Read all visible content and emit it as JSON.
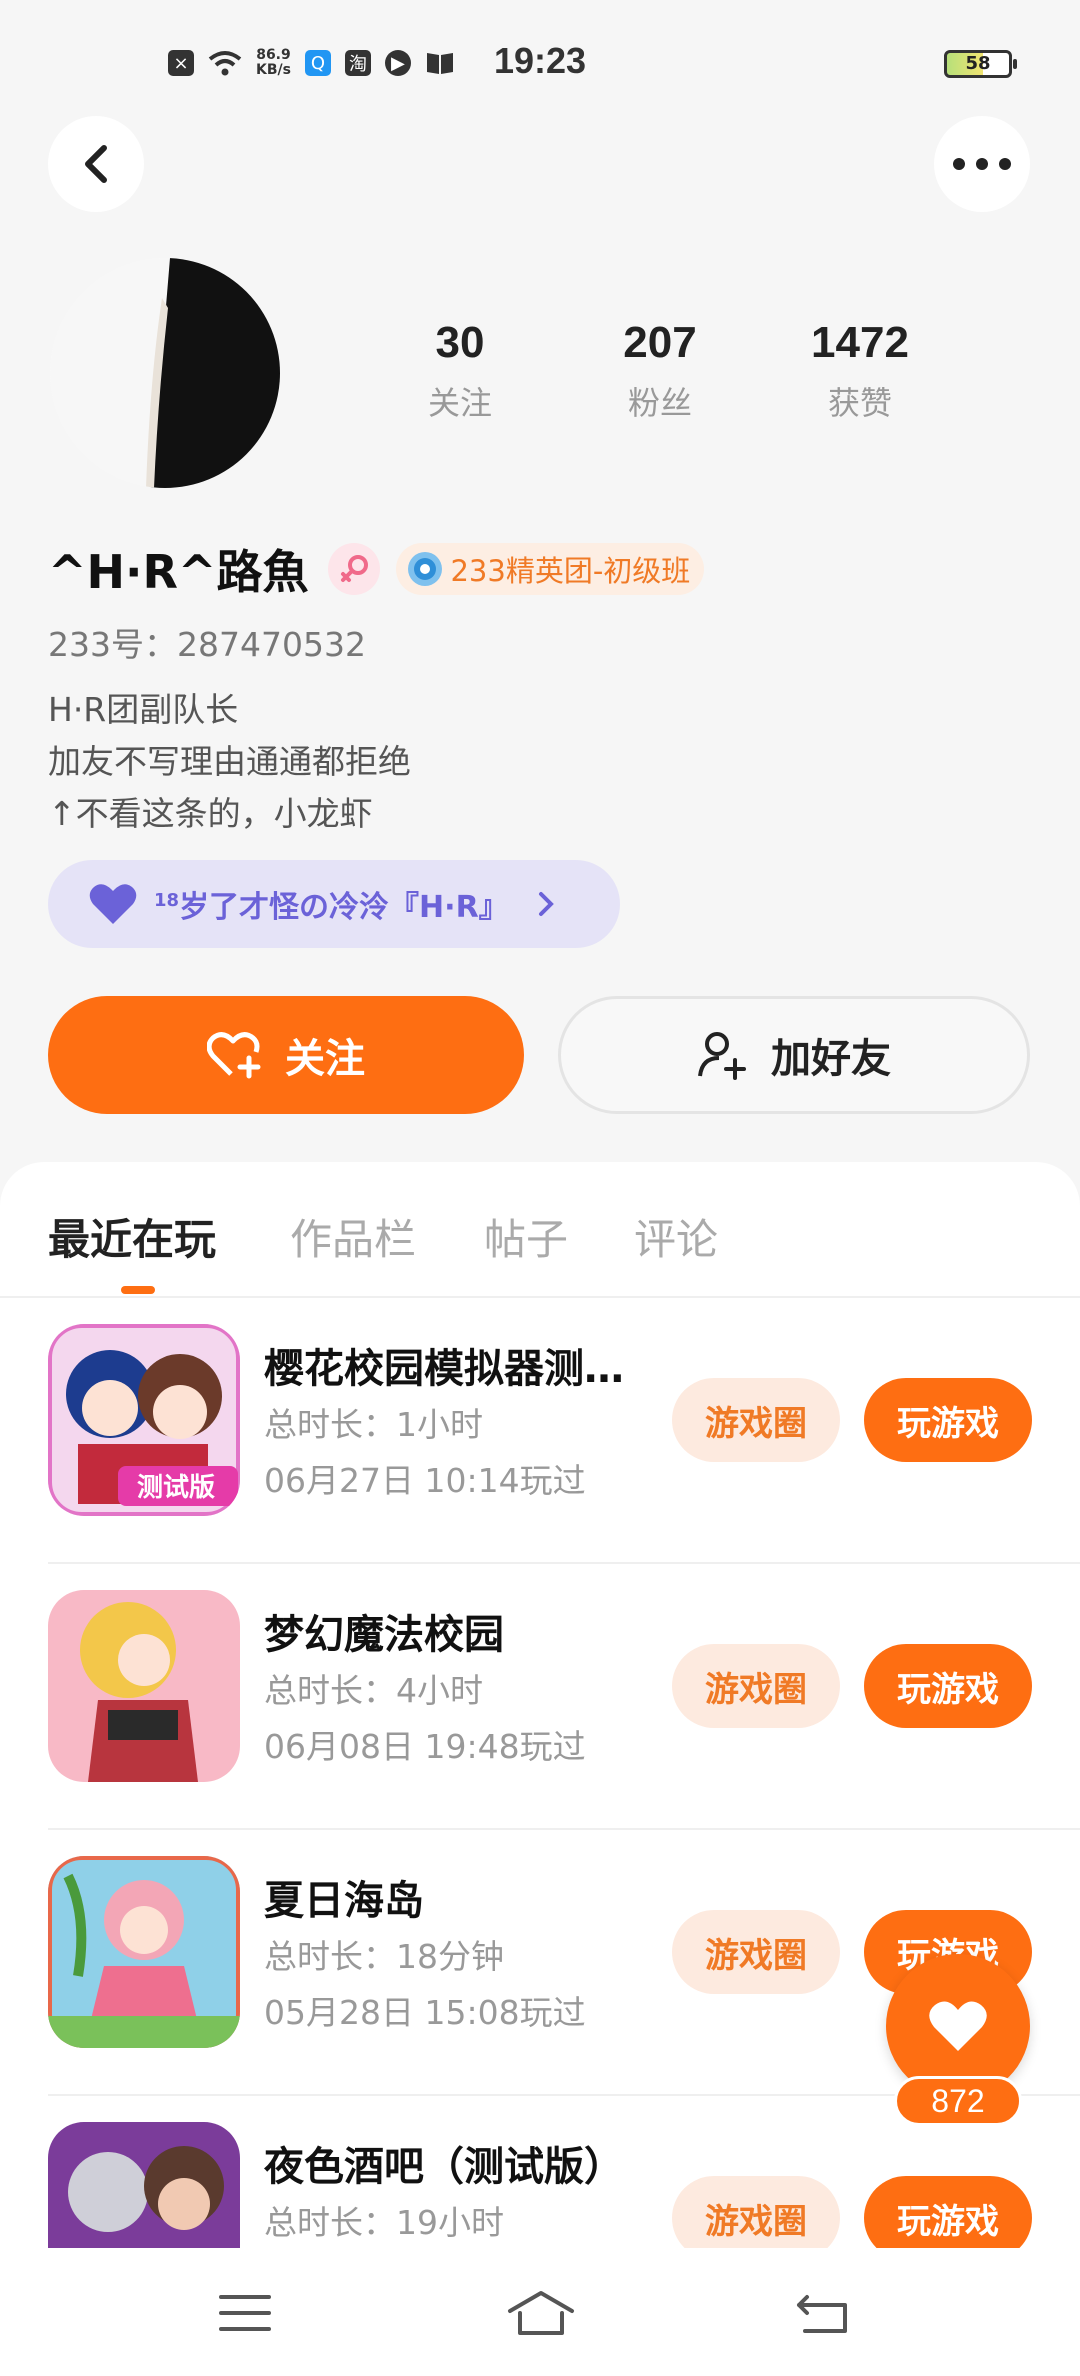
{
  "status_bar": {
    "speed_value": "86.9",
    "speed_unit": "KB/s",
    "icon_names": [
      "close-box-icon",
      "wifi-icon",
      "speed-icon",
      "browser-icon",
      "taobao-icon",
      "video-icon",
      "book-icon"
    ],
    "taobao_glyph": "淘",
    "time": "19:23",
    "battery": "58"
  },
  "profile": {
    "name": "^H·R^路魚",
    "badge_text": "233精英团-初级班",
    "uid_label": "233号：",
    "uid": "287470532",
    "bio": [
      "H·R团副队长",
      "加友不写理由通通都拒绝",
      "↑不看这条的，小龙虾"
    ],
    "group_prefix": "18",
    "group_name": "岁了才怪の冷泠『H·R』",
    "stats": [
      {
        "value": "30",
        "label": "关注"
      },
      {
        "value": "207",
        "label": "粉丝"
      },
      {
        "value": "1472",
        "label": "获赞"
      }
    ]
  },
  "actions": {
    "follow_label": "关注",
    "add_friend_label": "加好友"
  },
  "tabs": [
    "最近在玩",
    "作品栏",
    "帖子",
    "评论"
  ],
  "active_tab": "最近在玩",
  "games": [
    {
      "title": "樱花校园模拟器测试版",
      "duration": "总时长：1小时",
      "last_played": "06月27日 10:14玩过",
      "circle_label": "游戏圈",
      "play_label": "玩游戏"
    },
    {
      "title": "梦幻魔法校园",
      "duration": "总时长：4小时",
      "last_played": "06月08日 19:48玩过",
      "circle_label": "游戏圈",
      "play_label": "玩游戏"
    },
    {
      "title": "夏日海岛",
      "duration": "总时长：18分钟",
      "last_played": "05月28日 15:08玩过",
      "circle_label": "游戏圈",
      "play_label": "玩游戏"
    },
    {
      "title": "夜色酒吧（测试版）",
      "duration": "总时长：19小时",
      "last_played": "",
      "circle_label": "游戏圈",
      "play_label": "玩游戏"
    }
  ],
  "thumb_texts": [
    "测试版"
  ],
  "like_fab": {
    "count": "872"
  },
  "colors": {
    "accent": "#fe6e12",
    "accent_light": "#fdeadf",
    "group_purple": "#6b62d8"
  }
}
